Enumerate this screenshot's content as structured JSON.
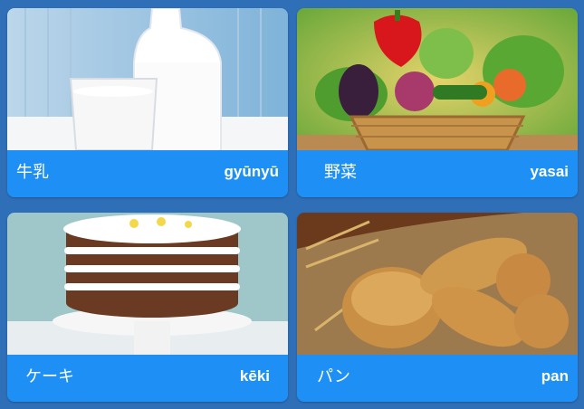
{
  "cards": [
    {
      "japanese": "牛乳",
      "romaji": "gyūnyū",
      "image": "milk-photo"
    },
    {
      "japanese": "野菜",
      "romaji": "yasai",
      "image": "vegetables-photo"
    },
    {
      "japanese": "ケーキ",
      "romaji": "kēki",
      "image": "cake-photo"
    },
    {
      "japanese": "パン",
      "romaji": "pan",
      "image": "bread-photo"
    }
  ],
  "colors": {
    "background": "#2f6fb8",
    "card_caption": "#1e90f5",
    "text": "#ffffff"
  }
}
